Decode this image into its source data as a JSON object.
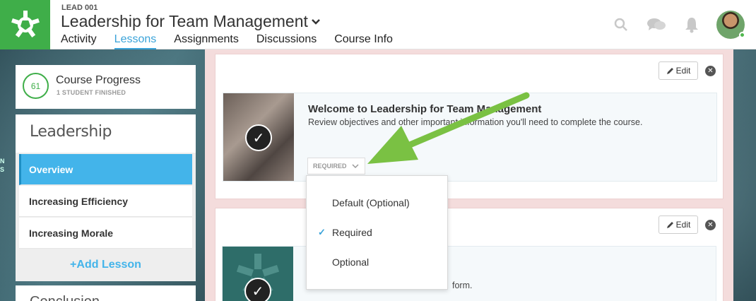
{
  "header": {
    "course_code": "LEAD 001",
    "course_title": "Leadership for Team Management",
    "tabs": [
      {
        "label": "Activity"
      },
      {
        "label": "Lessons",
        "active": true
      },
      {
        "label": "Assignments"
      },
      {
        "label": "Discussions"
      },
      {
        "label": "Course Info"
      }
    ],
    "icons": [
      "search-icon",
      "chat-icon",
      "bell-icon",
      "avatar"
    ]
  },
  "sidebar": {
    "progress": {
      "value": "61",
      "title": "Course Progress",
      "subtitle": "1 STUDENT FINISHED"
    },
    "module_title": "Leadership",
    "lessons": [
      {
        "label": "Overview",
        "active": true
      },
      {
        "label": "Increasing Efficiency"
      },
      {
        "label": "Increasing Morale"
      }
    ],
    "add_lesson": "+Add Lesson",
    "next_module_title": "Conclusion",
    "edge_letters": [
      "N",
      "S"
    ]
  },
  "main": {
    "edit_label": "Edit",
    "lesson1": {
      "title": "Welcome to Leadership for Team Management",
      "description": "Review objectives and other important information you'll need to complete the course.",
      "requirement": "REQUIRED"
    },
    "lesson2": {
      "description_tail": "form."
    },
    "dropdown": {
      "options": [
        {
          "label": "Default (Optional)",
          "selected": false
        },
        {
          "label": "Required",
          "selected": true
        },
        {
          "label": "Optional",
          "selected": false
        }
      ]
    }
  },
  "colors": {
    "brand_green": "#3fae49",
    "accent_blue": "#43b4ea",
    "arrow_green": "#7ac143"
  }
}
